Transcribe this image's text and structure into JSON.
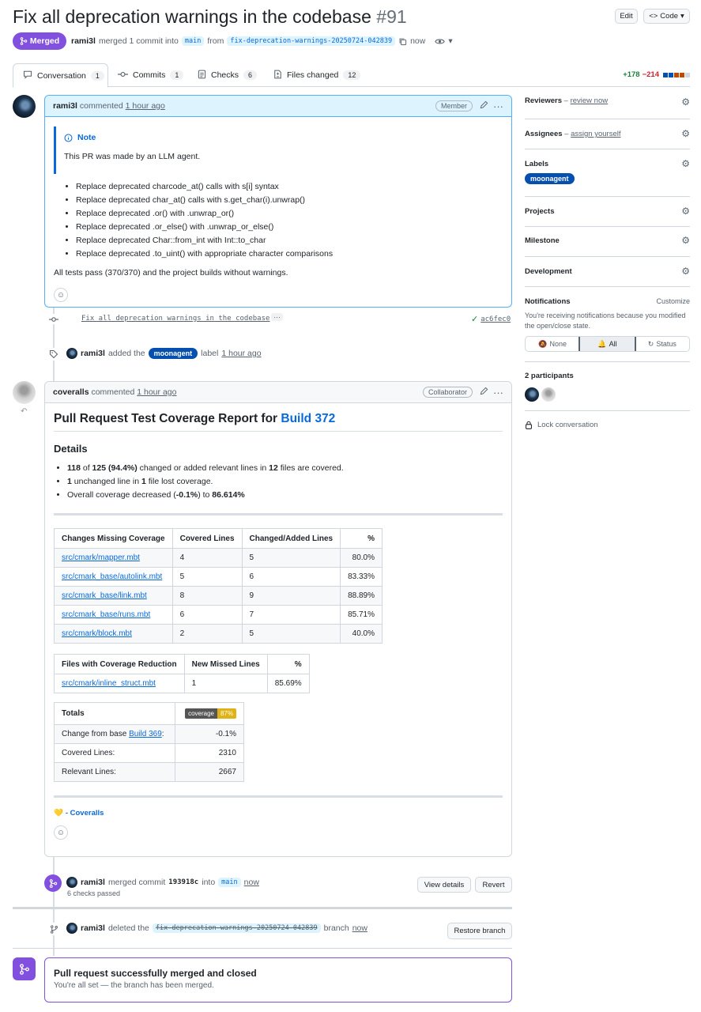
{
  "header": {
    "title": "Fix all deprecation warnings in the codebase",
    "number": "#91",
    "edit_label": "Edit",
    "code_label": "Code",
    "state": "Merged",
    "author": "rami3l",
    "merge_text": "merged 1 commit into",
    "base_branch": "main",
    "from_text": "from",
    "head_branch": "fix-deprecation-warnings-20250724-042839",
    "time": "now"
  },
  "tabs": [
    {
      "label": "Conversation",
      "count": "1"
    },
    {
      "label": "Commits",
      "count": "1"
    },
    {
      "label": "Checks",
      "count": "6"
    },
    {
      "label": "Files changed",
      "count": "12"
    }
  ],
  "diffstat": {
    "additions": "+178",
    "deletions": "−214"
  },
  "comment1": {
    "author": "rami3l",
    "action": "commented",
    "time": "1 hour ago",
    "role": "Member",
    "note_title": "Note",
    "note_text": "This PR was made by an LLM agent.",
    "bullets": [
      "Replace deprecated charcode_at() calls with s[i] syntax",
      "Replace deprecated char_at() calls with s.get_char(i).unwrap()",
      "Replace deprecated .or() with .unwrap_or()",
      "Replace deprecated .or_else() with .unwrap_or_else()",
      "Replace deprecated Char::from_int with Int::to_char",
      "Replace deprecated .to_uint() with appropriate character comparisons"
    ],
    "footer": "All tests pass (370/370) and the project builds without warnings."
  },
  "commit": {
    "message": "Fix all deprecation warnings in the codebase",
    "more": "···",
    "sha": "ac6fec0"
  },
  "label_event": {
    "author": "rami3l",
    "text1": "added the",
    "label": "moonagent",
    "text2": "label",
    "time": "1 hour ago"
  },
  "comment2": {
    "author": "coveralls",
    "action": "commented",
    "time": "1 hour ago",
    "role": "Collaborator",
    "heading": "Pull Request Test Coverage Report for",
    "build_link": "Build 372",
    "details_heading": "Details",
    "detail1": {
      "a": "118",
      "t1": " of ",
      "b": "125 (94.4%)",
      "t2": " changed or added relevant lines in ",
      "c": "12",
      "t3": " files are covered."
    },
    "detail2": {
      "a": "1",
      "t1": " unchanged line in ",
      "b": "1",
      "t2": " file lost coverage."
    },
    "detail3": {
      "t1": "Overall coverage decreased (",
      "a": "-0.1%",
      "t2": ") to ",
      "b": "86.614%"
    },
    "table1": {
      "headers": [
        "Changes Missing Coverage",
        "Covered Lines",
        "Changed/Added Lines",
        "%"
      ],
      "rows": [
        [
          "src/cmark/mapper.mbt",
          "4",
          "5",
          "80.0%"
        ],
        [
          "src/cmark_base/autolink.mbt",
          "5",
          "6",
          "83.33%"
        ],
        [
          "src/cmark_base/link.mbt",
          "8",
          "9",
          "88.89%"
        ],
        [
          "src/cmark_base/runs.mbt",
          "6",
          "7",
          "85.71%"
        ],
        [
          "src/cmark/block.mbt",
          "2",
          "5",
          "40.0%"
        ]
      ]
    },
    "table2": {
      "headers": [
        "Files with Coverage Reduction",
        "New Missed Lines",
        "%"
      ],
      "rows": [
        [
          "src/cmark/inline_struct.mbt",
          "1",
          "85.69%"
        ]
      ]
    },
    "table3": {
      "header": "Totals",
      "badge_left": "coverage",
      "badge_right": "87%",
      "row1_label": "Change from base ",
      "row1_link": "Build 369",
      "row1_colon": ":",
      "row1_value": "-0.1%",
      "row2_label": "Covered Lines:",
      "row2_value": "2310",
      "row3_label": "Relevant Lines:",
      "row3_value": "2667"
    },
    "signature_emoji": "💛",
    "signature": "- Coveralls"
  },
  "merge_event": {
    "author": "rami3l",
    "text1": "merged commit",
    "sha": "193918c",
    "text2": "into",
    "branch": "main",
    "time": "now",
    "checks": "6 checks passed",
    "view_details": "View details",
    "revert": "Revert"
  },
  "delete_event": {
    "author": "rami3l",
    "text1": "deleted the",
    "branch": "fix-deprecation-warnings-20250724-042839",
    "text2": "branch",
    "time": "now",
    "restore": "Restore branch"
  },
  "merged_box": {
    "title": "Pull request successfully merged and closed",
    "subtitle": "You're all set — the branch has been merged."
  },
  "sidebar": {
    "reviewers": "Reviewers",
    "reviewers_action": "review now",
    "assignees": "Assignees",
    "assignees_action": "assign yourself",
    "labels": "Labels",
    "label_value": "moonagent",
    "projects": "Projects",
    "milestone": "Milestone",
    "development": "Development",
    "notifications": "Notifications",
    "customize": "Customize",
    "notif_text": "You're receiving notifications because you modified the open/close state.",
    "notif_none": "None",
    "notif_all": "All",
    "notif_status": "Status",
    "participants": "2 participants",
    "lock": "Lock conversation"
  },
  "colors": {
    "merged": "#8250df",
    "link": "#0969da",
    "label": "#0550ae",
    "add": "#1a7f37",
    "del": "#cf222e"
  }
}
